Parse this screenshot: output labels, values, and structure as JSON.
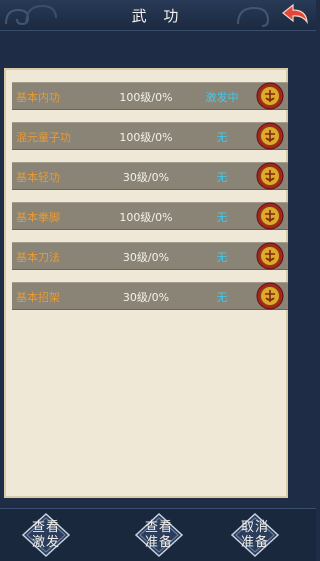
{
  "header": {
    "title": "武 功"
  },
  "skills": [
    {
      "name": "基本内功",
      "level": "100级/0%",
      "status": "激发中"
    },
    {
      "name": "混元童子功",
      "level": "100级/0%",
      "status": "无"
    },
    {
      "name": "基本轻功",
      "level": "30级/0%",
      "status": "无"
    },
    {
      "name": "基本拳脚",
      "level": "100级/0%",
      "status": "无"
    },
    {
      "name": "基本刀法",
      "level": "30级/0%",
      "status": "无"
    },
    {
      "name": "基本招架",
      "level": "30级/0%",
      "status": "无"
    }
  ],
  "buttons": {
    "view_activate": [
      "查看",
      "激发"
    ],
    "view_prepare": [
      "查看",
      "准备"
    ],
    "cancel_prepare": [
      "取消",
      "准备"
    ]
  },
  "icons": {
    "back": "back-arrow-icon",
    "row_action": "medal-icon"
  },
  "colors": {
    "skill_name": "#e79b35",
    "level": "#f4f2ec",
    "status": "#41c8ec",
    "row_bg": "#8a8476",
    "panel_bg": "#efe8d6",
    "frame_bg": "#1e2d45",
    "medal_red": "#a8231e",
    "medal_gold": "#e1a92b"
  }
}
